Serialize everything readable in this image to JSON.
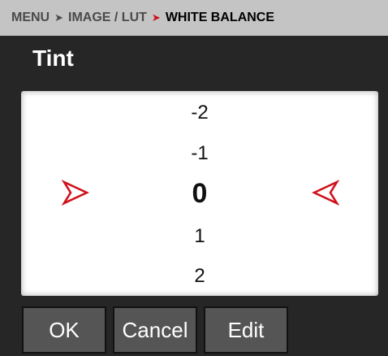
{
  "breadcrumb": {
    "items": [
      "MENU",
      "IMAGE / LUT",
      "WHITE BALANCE"
    ],
    "separator": "➤"
  },
  "title": "Tint",
  "picker": {
    "values": [
      "-2",
      "-1",
      "0",
      "1",
      "2"
    ],
    "selected": "0",
    "left_indicator_icon": "arrow-right-outline-icon",
    "right_indicator_icon": "arrow-left-outline-icon",
    "indicator_color": "#d0101a"
  },
  "buttons": {
    "ok_label": "OK",
    "cancel_label": "Cancel",
    "edit_label": "Edit"
  }
}
